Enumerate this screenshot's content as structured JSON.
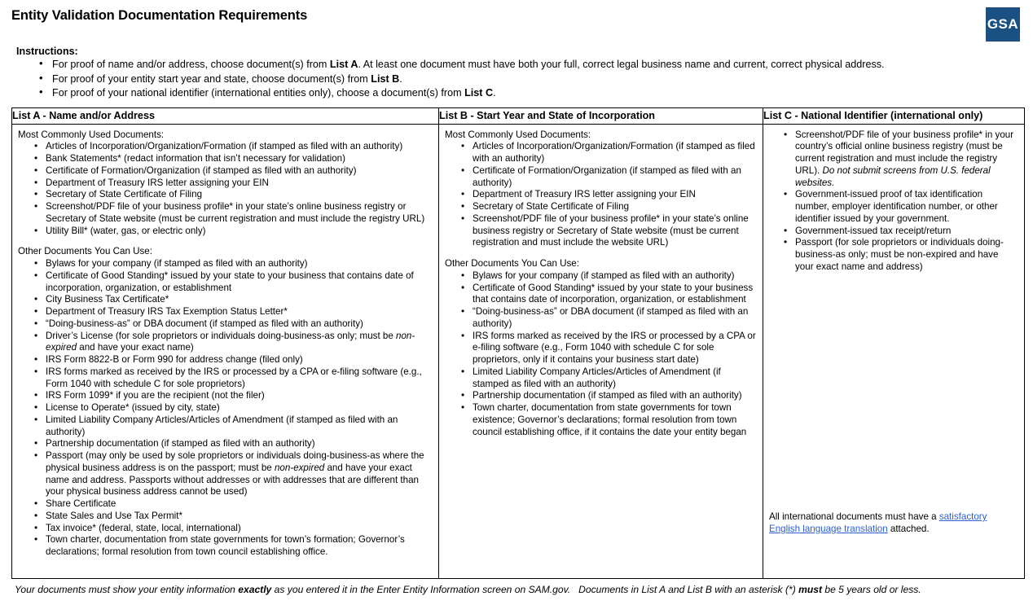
{
  "document": {
    "title": "Entity Validation Documentation Requirements",
    "logo_text": "GSA",
    "logo_color": "#1b5182",
    "link_color": "#2c5fd3"
  },
  "instructions": {
    "heading": "Instructions:",
    "items": [
      "For proof of name and/or address, choose document(s) from List A. At least one document must have both your full, correct legal business name and current, correct physical address.",
      "For proof of your entity start year and state, choose document(s) from List B.",
      "For proof of your national identifier (international entities only), choose a document(s) from List C."
    ]
  },
  "table": {
    "headers": {
      "list_a": "List A - Name and/or Address",
      "list_b": "List B - Start Year and State of Incorporation",
      "list_c": "List C - National Identifier (international only)"
    },
    "group_labels": {
      "common": "Most Commonly Used Documents:",
      "other": "Other Documents You Can Use:"
    },
    "list_a": {
      "common": [
        "Articles of Incorporation/Organization/Formation (if stamped as filed with an authority)",
        "Bank Statements* (redact information that isn’t necessary for validation)",
        "Certificate of Formation/Organization (if stamped as filed with an authority)",
        "Department of Treasury IRS letter assigning your EIN",
        "Secretary of State Certificate of Filing",
        "Screenshot/PDF file of your business profile* in your state’s online business registry or Secretary of State website (must be current registration and must include the registry URL)",
        "Utility Bill* (water, gas, or electric only)"
      ],
      "other": [
        "Bylaws for your company (if stamped as filed with an authority)",
        "Certificate of Good Standing* issued by your state to your business that contains date of incorporation, organization, or establishment",
        "City Business Tax Certificate*",
        "Department of Treasury IRS Tax Exemption Status Letter*",
        "“Doing-business-as” or DBA document (if stamped as filed with an authority)",
        "Driver’s License (for sole proprietors or individuals doing-business-as only; must be non-expired and have your exact name)",
        "IRS Form 8822-B or Form 990 for address change (filed only)",
        "IRS forms marked as received by the IRS or processed by a CPA or e-filing software (e.g., Form 1040 with schedule C for sole proprietors)",
        "IRS Form 1099* if you are the recipient (not the filer)",
        "License to Operate* (issued by city, state)",
        "Limited Liability Company Articles/Articles of Amendment  (if stamped as filed with an authority)",
        "Partnership documentation  (if stamped as filed with an authority)",
        "Passport (may only be used by sole proprietors or individuals doing-business-as where the physical business address is on the passport; must be non-expired and have your exact name and address. Passports without addresses or with addresses that are different than your physical business address cannot be used)",
        "Share Certificate",
        "State Sales and Use Tax Permit*",
        "Tax invoice* (federal, state, local, international)",
        "Town charter, documentation from state governments for town’s formation; Governor’s declarations; formal resolution from town council establishing office."
      ],
      "driver_license_italic": "non-expired"
    },
    "list_b": {
      "common": [
        "Articles of Incorporation/Organization/Formation (if stamped as filed with an authority)",
        "Certificate of Formation/Organization (if stamped as filed with an authority)",
        "Department of Treasury IRS letter assigning your EIN",
        "Secretary of State Certificate of Filing",
        "Screenshot/PDF file of your business profile* in your state’s online business registry or Secretary of State website (must be current registration and must include the website URL)"
      ],
      "other": [
        "Bylaws for your company (if stamped as filed with an authority)",
        "Certificate of Good Standing* issued by your state to your business that contains date of incorporation, organization, or establishment",
        "“Doing-business-as” or DBA document (if stamped as filed with an authority)",
        "IRS forms marked as received by the IRS or processed by a CPA or e-filing software (e.g., Form 1040 with schedule C for sole proprietors, only if it contains your business start date)",
        "Limited Liability Company Articles/Articles of Amendment (if stamped as filed with an authority)",
        "Partnership documentation (if stamped as filed with an authority)",
        "Town charter, documentation from state governments for town existence; Governor’s declarations; formal resolution from town council establishing office, if it contains the date your entity began"
      ]
    },
    "list_c": {
      "items": [
        "Screenshot/PDF file of your business profile* in your country’s official online business registry (must be current registration and must include the registry URL). Do not submit screens from U.S. federal websites.",
        "Government-issued proof of tax identification number, employer identification number, or other identifier issued by your government.",
        "Government-issued tax receipt/return",
        "Passport (for sole proprietors or individuals doing-business-as only; must be non-expired and have your exact name and address)"
      ],
      "screenshot_italic_note": "Do not submit screens from U.S. federal websites.",
      "translation_note_prefix": "All international documents must have a ",
      "translation_note_link": "satisfactory English language translation",
      "translation_note_suffix": " attached."
    }
  },
  "footer": {
    "part1": "Your documents must show your entity information ",
    "bold1": "exactly",
    "part2": " as you entered it in the Enter Entity Information screen on SAM.gov.",
    "part3": "Documents in List A and List B with an asterisk (*) ",
    "bold2": "must",
    "part4": " be 5 years old or less."
  }
}
